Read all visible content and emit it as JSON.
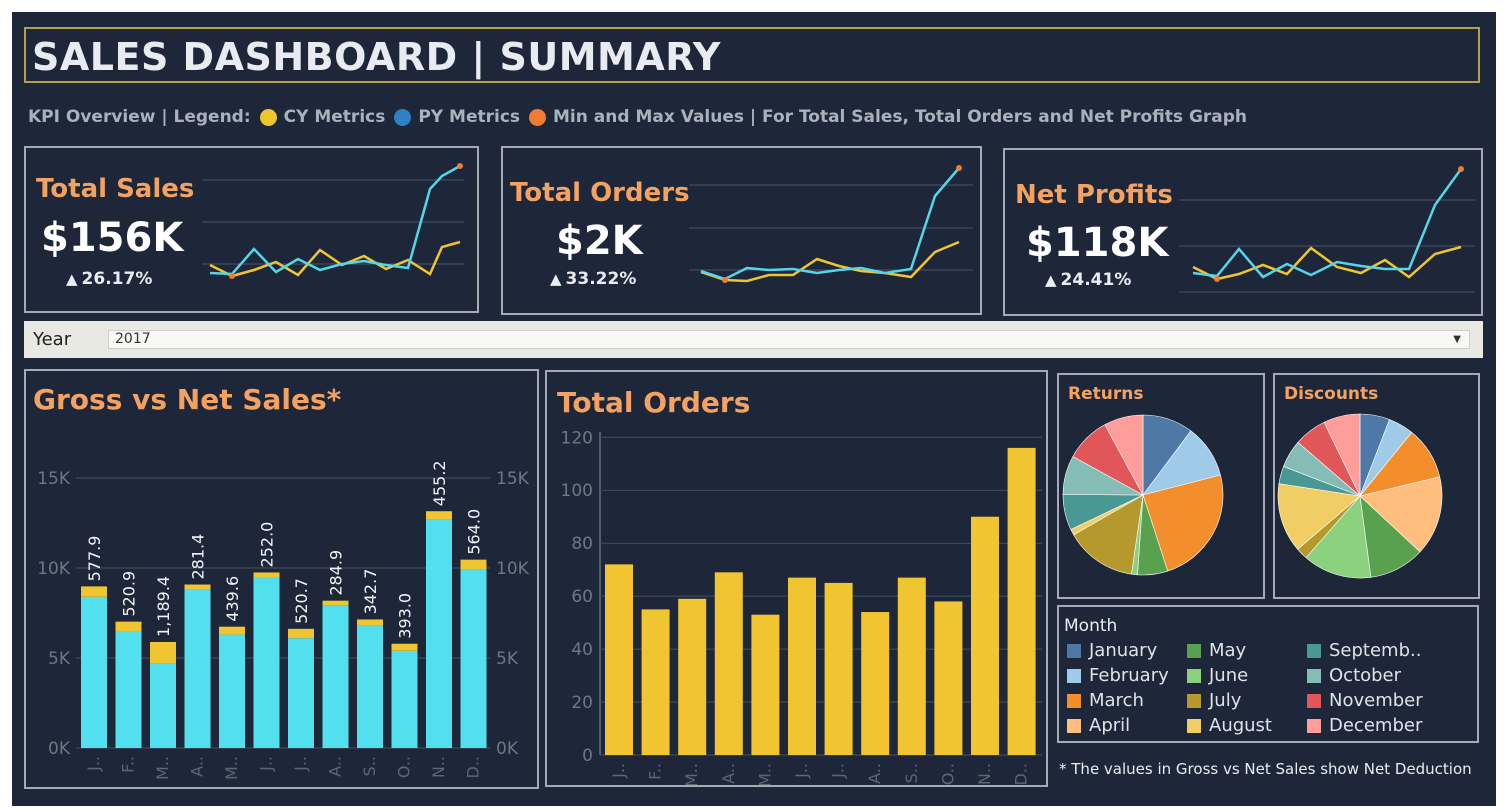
{
  "header": {
    "title": "SALES DASHBOARD | SUMMARY",
    "legend_prefix": "KPI Overview | Legend:",
    "legend_cy": "CY Metrics",
    "legend_py": "PY Metrics",
    "legend_minmax": "Min and Max Values | For Total Sales, Total Orders and Net Profits Graph"
  },
  "colors": {
    "background": "#1d2739",
    "cy": "#f0c531",
    "py": "#55d6e8",
    "minmax": "#f07c32",
    "accent": "#f4a261",
    "gross_bar": "#f0c531",
    "net_bar": "#52dfee"
  },
  "kpis": [
    {
      "title": "Total Sales",
      "value": "$156K",
      "change": "26.17%",
      "direction": "up"
    },
    {
      "title": "Total Orders",
      "value": "$2K",
      "change": "33.22%",
      "direction": "up"
    },
    {
      "title": "Net Profits",
      "value": "$118K",
      "change": "24.41%",
      "direction": "up"
    }
  ],
  "filter": {
    "label": "Year",
    "value": "2017"
  },
  "legend": {
    "title": "Month",
    "items": [
      {
        "label": "January",
        "color": "#4e79a7"
      },
      {
        "label": "February",
        "color": "#a0cbe8"
      },
      {
        "label": "March",
        "color": "#f28e2b"
      },
      {
        "label": "April",
        "color": "#ffbe7d"
      },
      {
        "label": "May",
        "color": "#59a14f"
      },
      {
        "label": "June",
        "color": "#8cd17d"
      },
      {
        "label": "July",
        "color": "#b6992d"
      },
      {
        "label": "August",
        "color": "#f1ce63"
      },
      {
        "label": "Septemb..",
        "color": "#499894"
      },
      {
        "label": "October",
        "color": "#86bcb6"
      },
      {
        "label": "November",
        "color": "#e15759"
      },
      {
        "label": "December",
        "color": "#ff9d9a"
      }
    ]
  },
  "footnote": "* The values in Gross vs Net Sales show Net Deduction",
  "chart_data": [
    {
      "id": "total-sales-spark",
      "type": "line",
      "x": [
        1,
        2,
        3,
        4,
        5,
        6,
        7,
        8,
        9,
        10,
        11,
        12
      ],
      "series": [
        {
          "name": "CY Metrics",
          "values": [
            14,
            7,
            10,
            15,
            8,
            22,
            13,
            18,
            12,
            19,
            8,
            25
          ]
        },
        {
          "name": "PY Metrics",
          "values": [
            8,
            7,
            24,
            10,
            17,
            11,
            15,
            16,
            14,
            11,
            85,
            101
          ]
        }
      ],
      "min_point": {
        "x": 2,
        "series": "CY Metrics"
      },
      "max_point": {
        "x": 12,
        "series": "PY Metrics"
      }
    },
    {
      "id": "total-orders-spark",
      "type": "line",
      "x": [
        1,
        2,
        3,
        4,
        5,
        6,
        7,
        8,
        9,
        10,
        11,
        12
      ],
      "series": [
        {
          "name": "CY Metrics",
          "values": [
            17,
            12,
            10,
            16,
            16,
            26,
            20,
            15,
            14,
            12,
            30,
            37
          ]
        },
        {
          "name": "PY Metrics",
          "values": [
            18,
            11,
            19,
            18,
            19,
            17,
            18,
            19,
            15,
            18,
            70,
            88
          ]
        }
      ],
      "min_point": {
        "x": 2,
        "series": "CY Metrics"
      },
      "max_point": {
        "x": 12,
        "series": "PY Metrics"
      }
    },
    {
      "id": "net-profits-spark",
      "type": "line",
      "x": [
        1,
        2,
        3,
        4,
        5,
        6,
        7,
        8,
        9,
        10,
        11,
        12
      ],
      "series": [
        {
          "name": "CY Metrics",
          "values": [
            20,
            11,
            15,
            21,
            15,
            31,
            20,
            17,
            26,
            12,
            30,
            36
          ]
        },
        {
          "name": "PY Metrics",
          "values": [
            15,
            12,
            32,
            12,
            21,
            13,
            22,
            19,
            17,
            17,
            70,
            98
          ]
        }
      ],
      "min_point": {
        "x": 2,
        "series": "CY Metrics"
      },
      "max_point": {
        "x": 12,
        "series": "PY Metrics"
      }
    },
    {
      "id": "gross-vs-net",
      "type": "bar",
      "title": "Gross vs Net Sales*",
      "categories": [
        "J..",
        "F..",
        "M..",
        "A..",
        "M..",
        "J..",
        "J..",
        "A..",
        "S..",
        "O..",
        "N..",
        "D.."
      ],
      "series": [
        {
          "name": "Net",
          "values": [
            8400,
            6500,
            4700,
            8800,
            6300,
            9500,
            6100,
            7900,
            6800,
            5400,
            12700,
            9900
          ]
        },
        {
          "name": "Deduction",
          "values": [
            577.9,
            520.9,
            1189.4,
            281.4,
            439.6,
            252.0,
            520.7,
            284.9,
            342.7,
            393.0,
            455.2,
            564.0
          ]
        }
      ],
      "labels": [
        "577.9",
        "520.9",
        "1,189.4",
        "281.4",
        "439.6",
        "252.0",
        "520.7",
        "284.9",
        "342.7",
        "393.0",
        "455.2",
        "564.0"
      ],
      "yticks": [
        "0K",
        "5K",
        "10K",
        "15K"
      ],
      "ylim": [
        0,
        16500
      ],
      "grid": true
    },
    {
      "id": "total-orders",
      "type": "bar",
      "title": "Total Orders",
      "categories": [
        "J..",
        "F..",
        "M..",
        "A..",
        "M..",
        "J..",
        "J..",
        "A..",
        "S..",
        "O..",
        "N..",
        "D.."
      ],
      "values": [
        72,
        55,
        59,
        69,
        53,
        67,
        65,
        54,
        67,
        58,
        90,
        116
      ],
      "yticks": [
        0,
        20,
        40,
        60,
        80,
        100,
        120
      ],
      "ylim": [
        0,
        122
      ],
      "grid": true
    },
    {
      "id": "returns-pie",
      "type": "pie",
      "title": "Returns",
      "labels": [
        "January",
        "February",
        "March",
        "April",
        "May",
        "June",
        "July",
        "August",
        "September",
        "October",
        "November",
        "December"
      ],
      "values": [
        10.2,
        10.8,
        24,
        0,
        6.1,
        1.2,
        14.4,
        1.2,
        7.2,
        7.9,
        9.1,
        7.9
      ]
    },
    {
      "id": "discounts-pie",
      "type": "pie",
      "title": "Discounts",
      "labels": [
        "January",
        "February",
        "March",
        "April",
        "May",
        "June",
        "July",
        "August",
        "September",
        "October",
        "November",
        "December"
      ],
      "values": [
        6.1,
        5.2,
        10.8,
        16.3,
        11.4,
        14.1,
        2.4,
        14.2,
        3.6,
        5.7,
        6.7,
        7.5
      ]
    }
  ]
}
